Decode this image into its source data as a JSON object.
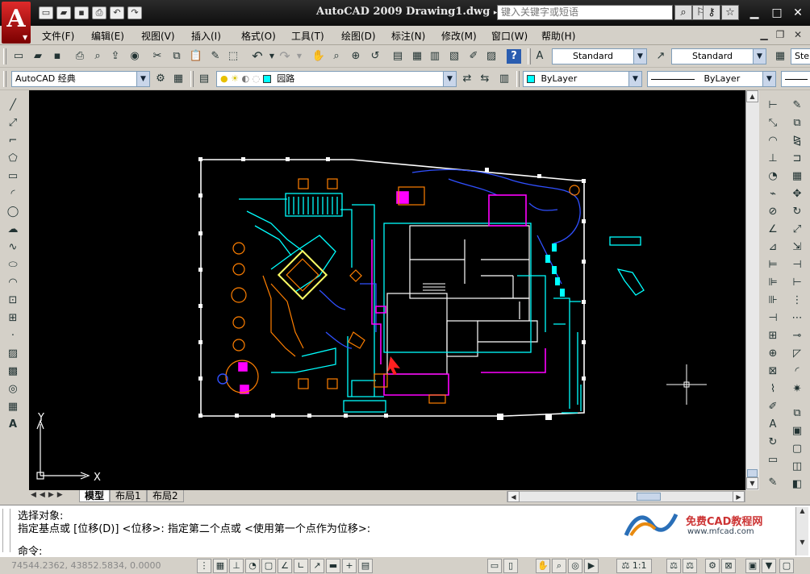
{
  "titlebar": {
    "app_title": "AutoCAD 2009",
    "doc_name": "Drawing1.dwg",
    "search_placeholder": "键入关键字或短语",
    "logo_letter": "A"
  },
  "menu": [
    "文件(F)",
    "编辑(E)",
    "视图(V)",
    "插入(I)",
    "格式(O)",
    "工具(T)",
    "绘图(D)",
    "标注(N)",
    "修改(M)",
    "窗口(W)",
    "帮助(H)"
  ],
  "toolbar1": {
    "text_style": "Standard",
    "dim_style": "Standard",
    "table_style_partial": "Ste"
  },
  "toolbar2": {
    "workspace": "AutoCAD 经典",
    "layer": "园路",
    "color": "ByLayer",
    "linetype": "ByLayer"
  },
  "ucs": {
    "y_label": "Y",
    "x_label": "X"
  },
  "tabs": [
    "模型",
    "布局1",
    "布局2"
  ],
  "command": {
    "line1": "选择对象:",
    "line2": "指定基点或 [位移(D)] <位移>:  指定第二个点或 <使用第一个点作为位移>:",
    "prompt": "命令:"
  },
  "watermark": {
    "title": "免费CAD教程网",
    "url": "www.mfcad.com"
  },
  "status": {
    "coords": "74544.2362, 43852.5834, 0.0000",
    "scale": "1:1"
  },
  "colors": {
    "canvas": "#000000",
    "cyan": "#00ffff",
    "magenta": "#ff00ff",
    "orange": "#ff7f00",
    "white": "#ffffff",
    "blue": "#3050ff"
  }
}
